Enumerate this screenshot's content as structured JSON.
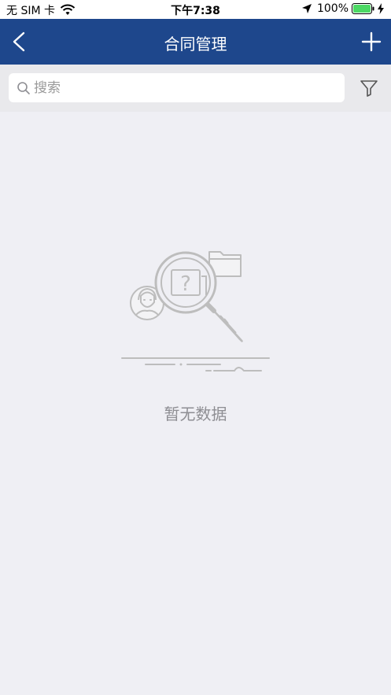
{
  "status_bar": {
    "carrier": "无 SIM 卡",
    "time": "下午7:38",
    "battery": "100%"
  },
  "nav": {
    "title": "合同管理",
    "back_icon": "chevron-left-icon",
    "add_icon": "plus-icon"
  },
  "search": {
    "placeholder": "搜索",
    "filter_icon": "filter-icon"
  },
  "empty_state": {
    "message": "暂无数据"
  },
  "colors": {
    "nav_bg": "#1e478c",
    "page_bg": "#efeff4",
    "illustration": "#bdbdbd"
  }
}
